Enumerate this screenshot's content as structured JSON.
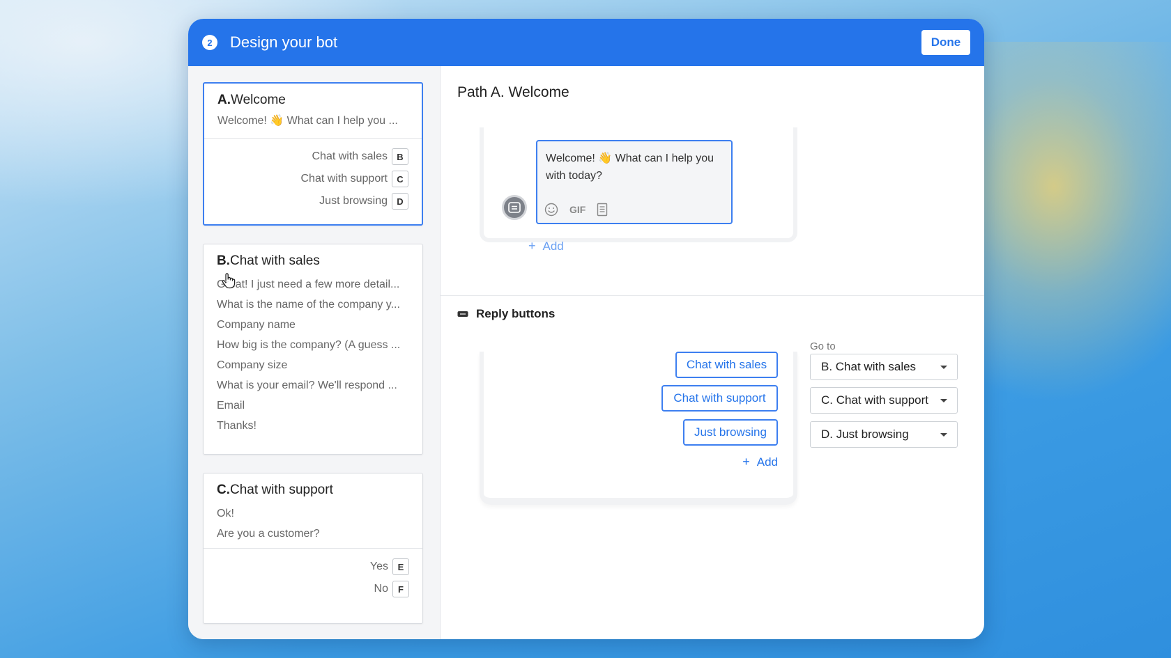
{
  "dialog": {
    "step_number": "2",
    "title": "Design your bot",
    "done_label": "Done"
  },
  "paths": [
    {
      "letter": "A.",
      "name": "Welcome",
      "lines": [
        "Welcome! 👋  What can I help you ..."
      ],
      "options": [
        {
          "label": "Chat with sales",
          "key": "B"
        },
        {
          "label": "Chat with support",
          "key": "C"
        },
        {
          "label": "Just browsing",
          "key": "D"
        }
      ]
    },
    {
      "letter": "B.",
      "name": "Chat with sales",
      "lines": [
        "Great! I just need a few more detail...",
        "What is the name of the company y...",
        "Company name",
        "How big is the company? (A guess ...",
        "Company size",
        "What is your email? We'll respond ...",
        "Email",
        "Thanks!"
      ]
    },
    {
      "letter": "C.",
      "name": "Chat with support",
      "lines": [
        "Ok!",
        "Are you a customer?"
      ],
      "options": [
        {
          "label": "Yes",
          "key": "E"
        },
        {
          "label": "No",
          "key": "F"
        }
      ]
    }
  ],
  "editor": {
    "path_title": "Path A. Welcome",
    "message_text": "Welcome! 👋  What can I help you with today?",
    "gif_label": "GIF",
    "add_label": "Add",
    "reply_section_title": "Reply buttons",
    "reply_buttons": [
      "Chat with sales",
      "Chat with support",
      "Just browsing"
    ],
    "reply_add_label": "Add",
    "goto_label": "Go to",
    "goto_selects": [
      "B. Chat with sales",
      "C. Chat with support",
      "D. Just browsing"
    ]
  },
  "colors": {
    "header": "#2574ea",
    "accent": "#3d7ff0"
  }
}
